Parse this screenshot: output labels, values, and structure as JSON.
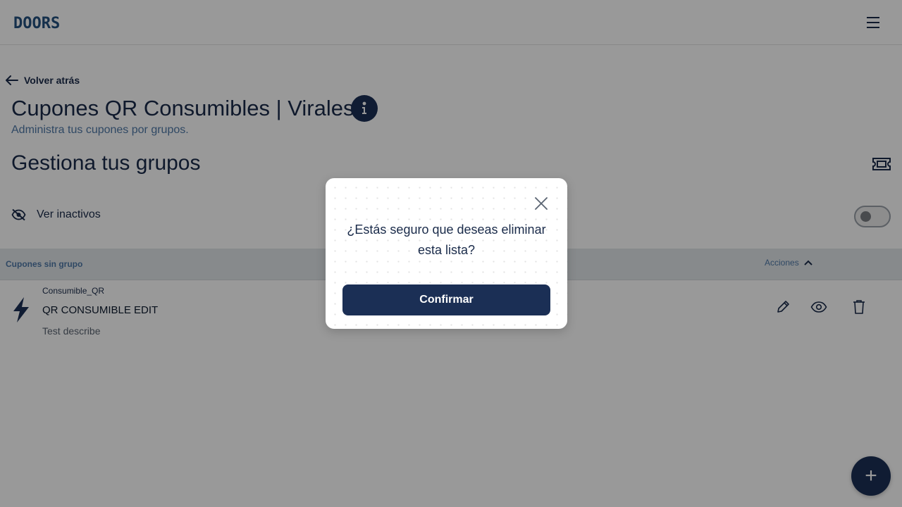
{
  "header": {
    "logo_text": "DOORS",
    "menu_icon": "hamburger-icon"
  },
  "navigation": {
    "back_label": "Volver atrás"
  },
  "page": {
    "title": "Cupones QR Consumibles | Virales",
    "subtitle": "Administra tus cupones por grupos.",
    "section_title": "Gestiona tus grupos",
    "inactive_label": "Ver inactivos",
    "inactive_toggle_on": false
  },
  "group": {
    "name": "Cupones sin grupo",
    "actions_label": "Acciones"
  },
  "coupon": {
    "type": "Consumible_QR",
    "name": "QR CONSUMIBLE EDIT",
    "description": "Test describe"
  },
  "fab": {
    "label": "+"
  },
  "modal": {
    "message": "¿Estás seguro que deseas eliminar esta lista?",
    "confirm_label": "Confirmar"
  },
  "colors": {
    "primary": "#1b2f55",
    "accent_text": "#4f79a7",
    "logo": "#23507f"
  }
}
